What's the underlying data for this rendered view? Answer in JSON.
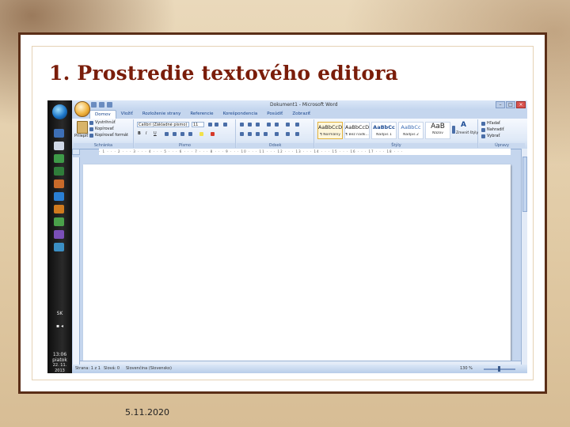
{
  "slide": {
    "title": "1. Prostredie textového editora",
    "date": "5.11.2020"
  },
  "colors": {
    "title": "#7a1d0a",
    "frame": "#5a2e17",
    "ribbon": "#dfe9f7",
    "page": "#ffffff"
  },
  "word": {
    "window_title": "Dokument1 - Microsoft Word",
    "tabs": [
      {
        "label": "Domov",
        "active": true
      },
      {
        "label": "Vložiť"
      },
      {
        "label": "Rozloženie strany"
      },
      {
        "label": "Referencie"
      },
      {
        "label": "Korešpondencia"
      },
      {
        "label": "Posúdiť"
      },
      {
        "label": "Zobraziť"
      }
    ],
    "clipboard": {
      "paste": "Prilepiť",
      "cut": "Vystrihnúť",
      "copy": "Kopírovať",
      "format_painter": "Kopírovať formát",
      "label": "Schránka"
    },
    "font": {
      "name": "Calibri (Základné písmo)",
      "size": "11",
      "label": "Písmo"
    },
    "paragraph": {
      "label": "Odsek"
    },
    "styles": {
      "items": [
        {
          "preview": "AaBbCcDc",
          "name": "¶ Normálny",
          "selected": true
        },
        {
          "preview": "AaBbCcDc",
          "name": "¶ Bez riadk..."
        },
        {
          "preview": "AaBbCc",
          "name": "Nadpis 1"
        },
        {
          "preview": "AaBbCc",
          "name": "Nadpis 2"
        },
        {
          "preview": "AaB",
          "name": "Názov"
        }
      ],
      "change_styles": "Zmeniť štýly",
      "label": "Štýly"
    },
    "editing": {
      "find": "Hľadať",
      "replace": "Nahradiť",
      "select": "Vybrať",
      "label": "Úpravy"
    },
    "status": {
      "page": "Strana: 1 z 1",
      "words": "Slová: 0",
      "language": "Slovenčina (Slovensko)",
      "zoom": "130 %"
    }
  },
  "taskbar": {
    "language": "SK",
    "time": "13:06",
    "day": "piatok",
    "date": "22. 11. 2013"
  }
}
